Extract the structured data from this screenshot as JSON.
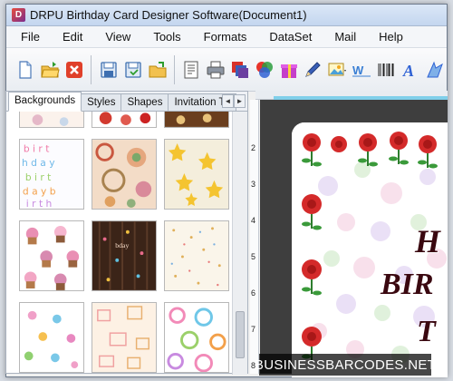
{
  "window": {
    "title": "DRPU Birthday Card Designer Software(Document1)",
    "app_icon_glyph": "D"
  },
  "menu": [
    "File",
    "Edit",
    "View",
    "Tools",
    "Formats",
    "DataSet",
    "Mail",
    "Help"
  ],
  "toolbar": {
    "buttons": [
      "new-document",
      "open-folder",
      "close",
      "save",
      "save-as",
      "open-template",
      "properties",
      "print",
      "layers",
      "color-circles",
      "gift",
      "pen",
      "image",
      "wordart",
      "barcode",
      "text",
      "shape"
    ]
  },
  "left_panel": {
    "tabs": [
      "Backgrounds",
      "Styles",
      "Shapes",
      "Invitation Te"
    ],
    "active_tab": "Backgrounds",
    "tab_scroll_left": "◄",
    "tab_scroll_right": "►"
  },
  "ruler": {
    "left_marks": [
      "2",
      "3",
      "4",
      "5",
      "6",
      "7",
      "8"
    ]
  },
  "card": {
    "line1": "H",
    "line2": "BIR",
    "line3": "T"
  },
  "watermark": "BUSINESSBARCODES.NET",
  "colors": {
    "accent": "#80cfea",
    "canvas": "#3e3e3e",
    "card_text": "#3a0810",
    "rose": "#d42a2a"
  }
}
